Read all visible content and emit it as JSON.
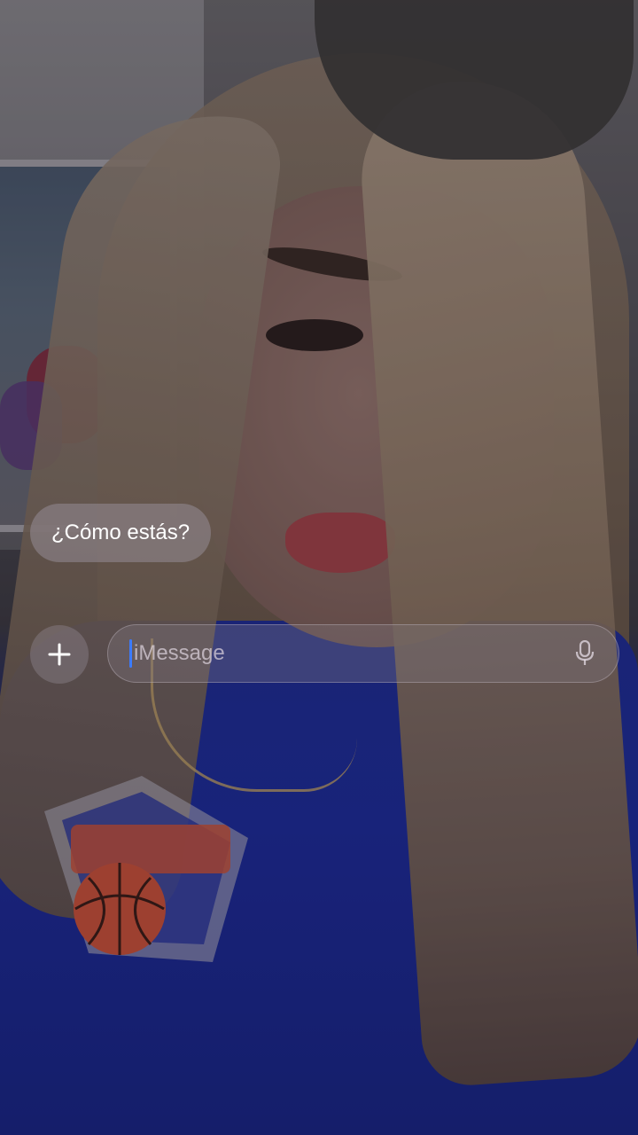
{
  "message_bubble": {
    "text": "¿Cómo estás?"
  },
  "composer": {
    "add_icon": "plus-icon",
    "placeholder": "iMessage",
    "value": "",
    "mic_icon": "microphone-icon"
  },
  "colors": {
    "caret": "#3b7bff",
    "bubble_bg": "rgba(150,140,150,0.55)",
    "text": "#ffffff"
  }
}
